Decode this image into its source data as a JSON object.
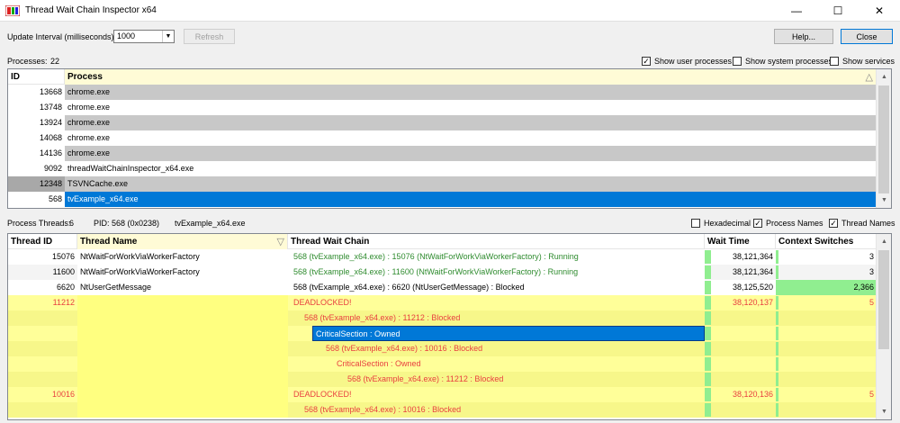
{
  "window": {
    "title": "Thread Wait Chain Inspector x64",
    "minimize": "—",
    "maximize": "☐",
    "close": "✕"
  },
  "toolbar": {
    "interval_label": "Update Interval (milliseconds):",
    "interval_value": "1000",
    "refresh": "Refresh",
    "help": "Help...",
    "close": "Close"
  },
  "processes": {
    "count_label": "Processes:",
    "count": "22",
    "show_user": "Show user processes",
    "show_system": "Show system processes",
    "show_services": "Show services",
    "columns": [
      "ID",
      "Process"
    ],
    "rows": [
      {
        "id": "13668",
        "name": "chrome.exe"
      },
      {
        "id": "13748",
        "name": "chrome.exe"
      },
      {
        "id": "13924",
        "name": "chrome.exe"
      },
      {
        "id": "14068",
        "name": "chrome.exe"
      },
      {
        "id": "14136",
        "name": "chrome.exe"
      },
      {
        "id": "9092",
        "name": "threadWaitChainInspector_x64.exe"
      },
      {
        "id": "12348",
        "name": "TSVNCache.exe"
      },
      {
        "id": "568",
        "name": "tvExample_x64.exe"
      }
    ]
  },
  "threads": {
    "count_label": "Process Threads:",
    "count": "6",
    "pid_label": "PID: 568 (0x0238)",
    "proc_name": "tvExample_x64.exe",
    "hexadecimal": "Hexadecimal",
    "process_names": "Process Names",
    "thread_names": "Thread Names",
    "columns": [
      "Thread ID",
      "Thread Name",
      "Thread Wait Chain",
      "Wait Time",
      "Context Switches"
    ],
    "rows": [
      {
        "tid": "15076",
        "tname": "NtWaitForWorkViaWorkerFactory",
        "chain": "568 (tvExample_x64.exe) : 15076 (NtWaitForWorkViaWorkerFactory) : Running",
        "wait": "38,121,364",
        "cs": "3"
      },
      {
        "tid": "11600",
        "tname": "NtWaitForWorkViaWorkerFactory",
        "chain": "568 (tvExample_x64.exe) : 11600 (NtWaitForWorkViaWorkerFactory) : Running",
        "wait": "38,121,364",
        "cs": "3"
      },
      {
        "tid": "6620",
        "tname": "NtUserGetMessage",
        "chain": "568 (tvExample_x64.exe) : 6620 (NtUserGetMessage) : Blocked",
        "wait": "38,125,520",
        "cs": "2,366"
      },
      {
        "tid": "11212",
        "tname": "",
        "chain": "DEADLOCKED!",
        "wait": "38,120,137",
        "cs": "5"
      },
      {
        "tid": "",
        "tname": "",
        "chain": "568 (tvExample_x64.exe) : 11212 : Blocked",
        "wait": "",
        "cs": ""
      },
      {
        "tid": "",
        "tname": "",
        "chain": "CriticalSection : Owned",
        "wait": "",
        "cs": ""
      },
      {
        "tid": "",
        "tname": "",
        "chain": "568 (tvExample_x64.exe) : 10016 : Blocked",
        "wait": "",
        "cs": ""
      },
      {
        "tid": "",
        "tname": "",
        "chain": "CriticalSection : Owned",
        "wait": "",
        "cs": ""
      },
      {
        "tid": "",
        "tname": "",
        "chain": "568 (tvExample_x64.exe) : 11212 : Blocked",
        "wait": "",
        "cs": ""
      },
      {
        "tid": "10016",
        "tname": "",
        "chain": "DEADLOCKED!",
        "wait": "38,120,136",
        "cs": "5"
      },
      {
        "tid": "",
        "tname": "",
        "chain": "568 (tvExample_x64.exe) : 10016 : Blocked",
        "wait": "",
        "cs": ""
      }
    ]
  },
  "colors": {
    "selection": "#0078d7",
    "deadlock_bg": "#ffff99",
    "deadlock_text": "#e84040",
    "running_text": "#2e8b2e",
    "green_bar": "#90ee90"
  }
}
